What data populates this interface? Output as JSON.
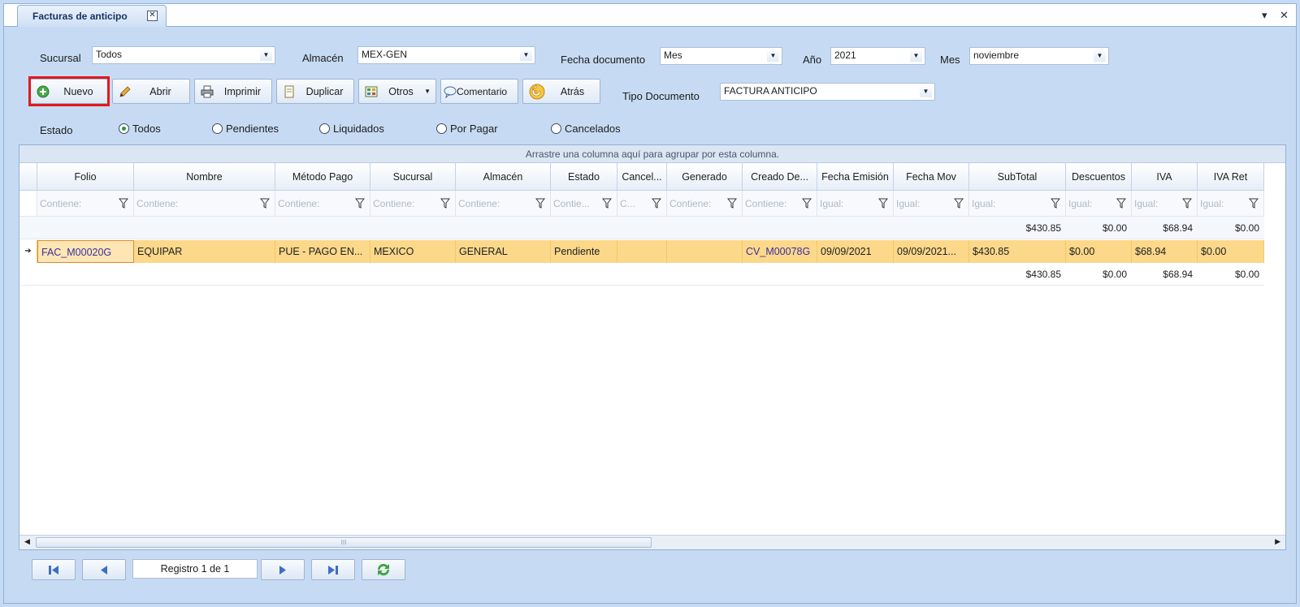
{
  "tab": {
    "title": "Facturas de anticipo",
    "close": "✕"
  },
  "window_controls": {
    "menu": "▾",
    "close": "✕"
  },
  "filters": {
    "sucursal_label": "Sucursal",
    "sucursal_value": "Todos",
    "almacen_label": "Almacén",
    "almacen_value": "MEX-GEN",
    "fecha_label": "Fecha documento",
    "fecha_value": "Mes",
    "anio_label": "Año",
    "anio_value": "2021",
    "mes_label": "Mes",
    "mes_value": "noviembre",
    "tipo_label": "Tipo Documento",
    "tipo_value": "FACTURA ANTICIPO"
  },
  "toolbar": {
    "nuevo": "Nuevo",
    "abrir": "Abrir",
    "imprimir": "Imprimir",
    "duplicar": "Duplicar",
    "otros": "Otros",
    "comentario": "Comentario",
    "atras": "Atrás"
  },
  "estado": {
    "label": "Estado",
    "options": [
      "Todos",
      "Pendientes",
      "Liquidados",
      "Por Pagar",
      "Cancelados"
    ],
    "selected": "Todos"
  },
  "grid": {
    "group_hint": "Arrastre una columna aquí para agrupar por esta columna.",
    "headers": [
      "Folio",
      "Nombre",
      "Método Pago",
      "Sucursal",
      "Almacén",
      "Estado",
      "Cancel...",
      "Generado",
      "Creado De...",
      "Fecha Emisión",
      "Fecha Mov",
      "SubTotal",
      "Descuentos",
      "IVA",
      "IVA Ret"
    ],
    "filters": [
      "Contiene:",
      "Contiene:",
      "Contiene:",
      "Contiene:",
      "Contiene:",
      "Contie...",
      "C...",
      "Contiene:",
      "Contiene:",
      "Igual:",
      "Igual:",
      "Igual:",
      "Igual:",
      "Igual:",
      "Igual:"
    ],
    "top_totals": {
      "subtotal": "$430.85",
      "descuentos": "$0.00",
      "iva": "$68.94",
      "iva_ret": "$0.00"
    },
    "rows": [
      [
        "FAC_M00020G",
        "EQUIPAR",
        "PUE - PAGO EN...",
        "MEXICO",
        "GENERAL",
        "Pendiente",
        "",
        "",
        "CV_M00078G",
        "09/09/2021",
        "09/09/2021...",
        "$430.85",
        "$0.00",
        "$68.94",
        "$0.00"
      ]
    ],
    "bottom_totals": {
      "subtotal": "$430.85",
      "descuentos": "$0.00",
      "iva": "$68.94",
      "iva_ret": "$0.00"
    }
  },
  "pager": {
    "text": "Registro  1  de  1"
  },
  "colors": {
    "selected_row": "#fbd88a",
    "highlight_box": "#e11a1a",
    "link": "#3a2fa0"
  }
}
